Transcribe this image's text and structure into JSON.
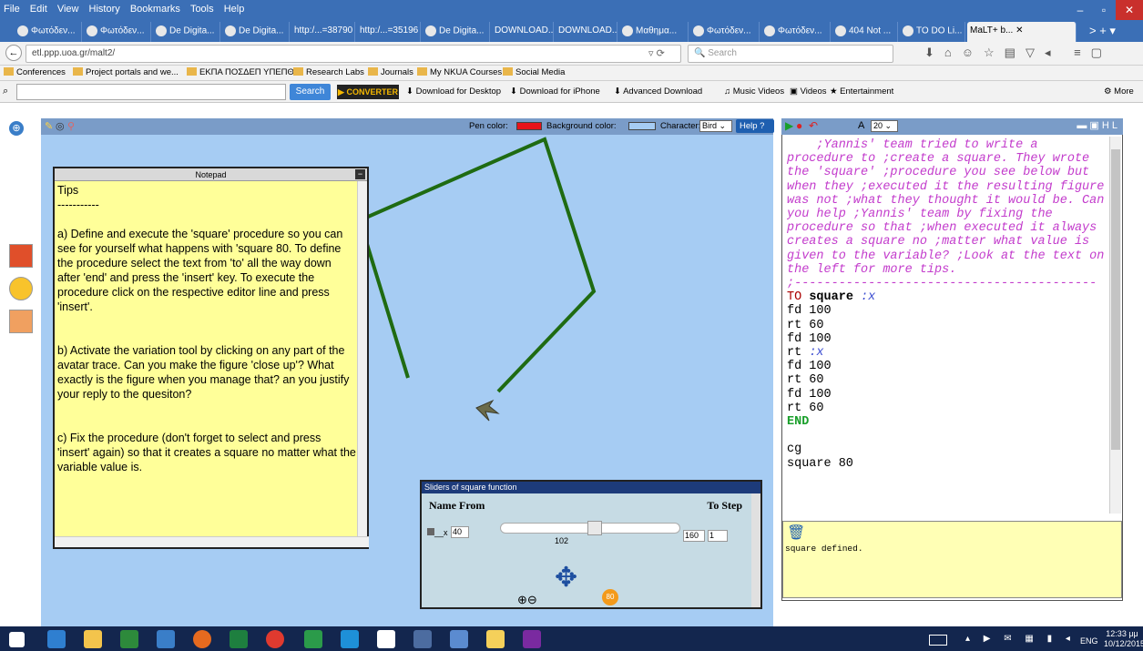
{
  "browser": {
    "menu": [
      "File",
      "Edit",
      "View",
      "History",
      "Bookmarks",
      "Tools",
      "Help"
    ],
    "tabs": [
      "Φωτόδεν...",
      "Φωτόδεν...",
      "De Digita...",
      "De Digita...",
      "http:/...=38790",
      "http:/...=35196",
      "De Digita...",
      "DOWNLOAD...",
      "DOWNLOAD...",
      "Μαθημα...",
      "Φωτόδεν...",
      "Φωτόδεν...",
      "404 Not ...",
      "TO DO Li...",
      "MaLT+ b..."
    ],
    "url": "etl.ppp.uoa.gr/malt2/",
    "search_placeholder": "Search",
    "bookmarks": [
      "Conferences",
      "Project portals and we...",
      "ΕΚΠΑ ΠΟΣΔΕΠ ΥΠΕΠΘ",
      "Research Labs",
      "Journals",
      "My NKUA Courses",
      "Social Media"
    ],
    "ext_search_button": "Search",
    "ext_items": [
      "Download for Desktop",
      "Download for iPhone",
      "Advanced Download",
      "Music Videos",
      "Videos",
      "Entertainment"
    ],
    "ext_more": "More"
  },
  "turtle_toolbar": {
    "pen_color_label": "Pen color:",
    "pen_color": "#e8131a",
    "bg_color_label": "Background color:",
    "bg_color": "#a6ccf3",
    "character_label": "Character:",
    "character_value": "Bird",
    "help_label": "Help"
  },
  "notepad": {
    "title": "Notepad",
    "text": "Tips\n-----------\n\na) Define and execute the 'square' procedure so you can see for yourself what happens with 'square 80. To define the procedure select the text from 'to' all the way down after 'end' and press the 'insert' key. To execute the procedure click on the respective editor line and press 'insert'.\n\n\nb) Activate the variation tool by clicking on any part of the avatar trace. Can you make the figure 'close up'? What exactly is the figure when you manage that? an you justify your reply to the quesiton?\n\n\nc) Fix the procedure (don't forget to select and press 'insert' again) so that it creates a square no matter what the variable value is."
  },
  "sliders": {
    "title": "Sliders of square function",
    "col_name_from": "Name From",
    "col_to_step": "To Step",
    "var_name": "x",
    "from": "40",
    "value": "102",
    "to": "160",
    "step": "1",
    "value_fraction": 0.52,
    "badge": "80"
  },
  "editor": {
    "font_size": "20",
    "comment": "    ;Yannis' team tried to write a procedure to ;create a square. They wrote the 'square' ;procedure you see below but when they ;executed it the resulting figure was not ;what they thought it would be. Can you help ;Yannis' team by fixing the procedure so that ;when executed it always creates a square no ;matter what value is given to the variable? ;Look at the text on the left for more tips.",
    "separator": ";-----------------------------------------",
    "lines": [
      "fd 100",
      "rt 60",
      "fd 100"
    ],
    "lines2": [
      "fd 100",
      "rt 60",
      "fd 100",
      "rt 60"
    ],
    "to_kw": "TO",
    "proc": "square",
    "param": ":x",
    "rt_var": "rt",
    "end_kw": "END",
    "after": [
      "cg",
      "square 80"
    ],
    "message": "square defined."
  },
  "taskbar": {
    "lang": "ENG",
    "time": "12:33 μμ",
    "date": "10/12/2015"
  },
  "colors": {
    "trace": "#1f6b12",
    "titlebar": "#3b6fb6"
  }
}
